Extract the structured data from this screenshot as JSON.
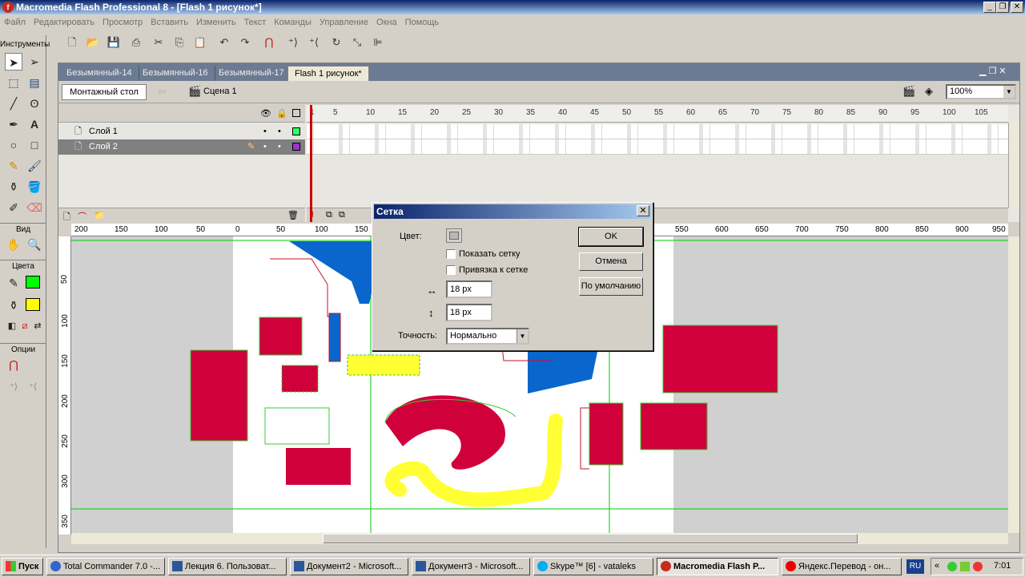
{
  "window": {
    "title": "Macromedia Flash Professional 8 - [Flash 1 рисунок*]"
  },
  "menu": [
    "Файл",
    "Редактировать",
    "Просмотр",
    "Вставить",
    "Изменить",
    "Текст",
    "Команды",
    "Управление",
    "Окна",
    "Помощь"
  ],
  "tools_panel": {
    "label": "Инструменты",
    "view_label": "Вид",
    "colors_label": "Цвета",
    "options_label": "Опции",
    "stroke_color": "#00ff00",
    "fill_color": "#ffff00"
  },
  "tabs": [
    "Безымянный-14",
    "Безымянный-16",
    "Безымянный-17",
    "Flash 1 рисунок*"
  ],
  "edit_bar": {
    "stage_button": "Монтажный стол",
    "scene": "Сцена 1",
    "zoom": "100%"
  },
  "timeline": {
    "layers": [
      {
        "name": "Слой 1",
        "color": "#33ff66"
      },
      {
        "name": "Слой 2",
        "color": "#9933cc"
      }
    ],
    "frame_numbers": [
      "1",
      "5",
      "10",
      "15",
      "20",
      "25",
      "30",
      "35",
      "40",
      "45",
      "50",
      "55",
      "60",
      "65",
      "70",
      "75",
      "80",
      "85",
      "90",
      "95",
      "100",
      "105"
    ]
  },
  "rulers": {
    "h": [
      "200",
      "150",
      "100",
      "50",
      "0",
      "50",
      "100",
      "150",
      "550",
      "600",
      "650",
      "700",
      "750",
      "800",
      "850",
      "900",
      "950"
    ],
    "v": [
      "50",
      "100",
      "150",
      "200",
      "250",
      "300",
      "350"
    ]
  },
  "dialog": {
    "title": "Сетка",
    "color_label": "Цвет:",
    "show_grid": "Показать сетку",
    "snap_grid": "Привязка к сетке",
    "width_value": "18 px",
    "height_value": "18 px",
    "accuracy_label": "Точность:",
    "accuracy_value": "Нормально",
    "ok": "OK",
    "cancel": "Отмена",
    "default": "По умолчанию"
  },
  "taskbar": {
    "start": "Пуск",
    "tasks": [
      "Total Commander 7.0 -...",
      "Лекция 6. Пользоват...",
      "Документ2 - Microsoft...",
      "Документ3 - Microsoft...",
      "Skype™ [6] - vataleks",
      "Macromedia Flash P...",
      "Яндекс.Перевод - он..."
    ],
    "lang": "RU",
    "time": "7:01"
  }
}
